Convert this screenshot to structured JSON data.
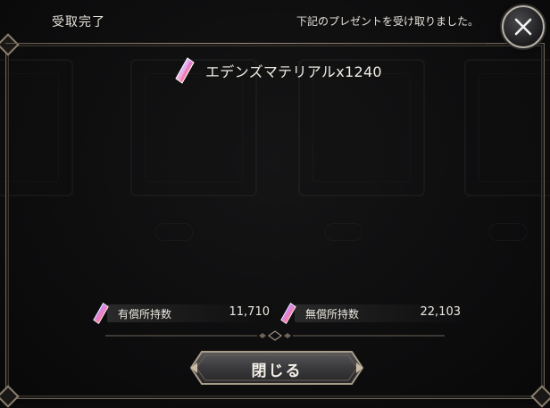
{
  "header": {
    "title": "受取完了",
    "message": "下記のプレゼントを受け取りました。"
  },
  "reward": {
    "icon": "crystal-icon",
    "text": "エデンズマテリアルx1240"
  },
  "stats": {
    "paid": {
      "label": "有償所持数",
      "value": "11,710"
    },
    "free": {
      "label": "無償所持数",
      "value": "22,103"
    }
  },
  "buttons": {
    "close_label": "閉じる"
  },
  "colors": {
    "frame": "#8a7e6c",
    "text": "#e8e4dc",
    "background": "#0b0b0c"
  }
}
